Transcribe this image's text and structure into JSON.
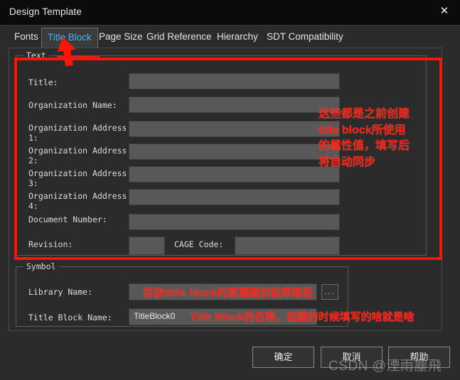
{
  "window": {
    "title": "Design Template",
    "close_icon": "close-icon",
    "close_glyph": "✕"
  },
  "tabs": [
    {
      "label": "Fonts",
      "active": false
    },
    {
      "label": "Title Block",
      "active": true
    },
    {
      "label": "Page Size",
      "active": false
    },
    {
      "label": "Grid Reference",
      "active": false
    },
    {
      "label": "Hierarchy",
      "active": false
    },
    {
      "label": "SDT Compatibility",
      "active": false
    }
  ],
  "groups": {
    "text": {
      "label": "Text"
    },
    "symbol": {
      "label": "Symbol"
    }
  },
  "text_fields": [
    {
      "label": "Title:",
      "value": ""
    },
    {
      "label": "Organization Name:",
      "value": ""
    },
    {
      "label": "Organization Address\n1:",
      "value": ""
    },
    {
      "label": "Organization Address\n2:",
      "value": ""
    },
    {
      "label": "Organization Address\n3:",
      "value": ""
    },
    {
      "label": "Organization Address\n4:",
      "value": ""
    },
    {
      "label": "Document Number:",
      "value": ""
    },
    {
      "label": "Revision:",
      "value": ""
    }
  ],
  "cage": {
    "label": "CAGE Code:",
    "value": ""
  },
  "symbol_fields": {
    "library_name_label": "Library Name:",
    "library_name_value": "",
    "browse_label": "...",
    "title_block_name_label": "Title Block Name:",
    "title_block_name_value": "TitleBlock0"
  },
  "buttons": {
    "ok": "确定",
    "cancel": "取消",
    "help": "帮助"
  },
  "annotations": {
    "attributes": "这些都是之前创建\ntitle block所使用\n的属性值，填写后\n将自动同步",
    "library": "存放titile block的原理图封装库路径",
    "title_block_name": "Title Block的名称，创建的时候填写的啥就是啥",
    "arrow_color": "#fb1408"
  },
  "watermark": "CSDN @湮雨塵飛",
  "colors": {
    "window_bg": "#2b2b2b",
    "titlebar_bg": "#0b0b0b",
    "field_bg": "#585858",
    "active_tab_text": "#4ab3f4",
    "annotation_red": "#fb1408"
  }
}
